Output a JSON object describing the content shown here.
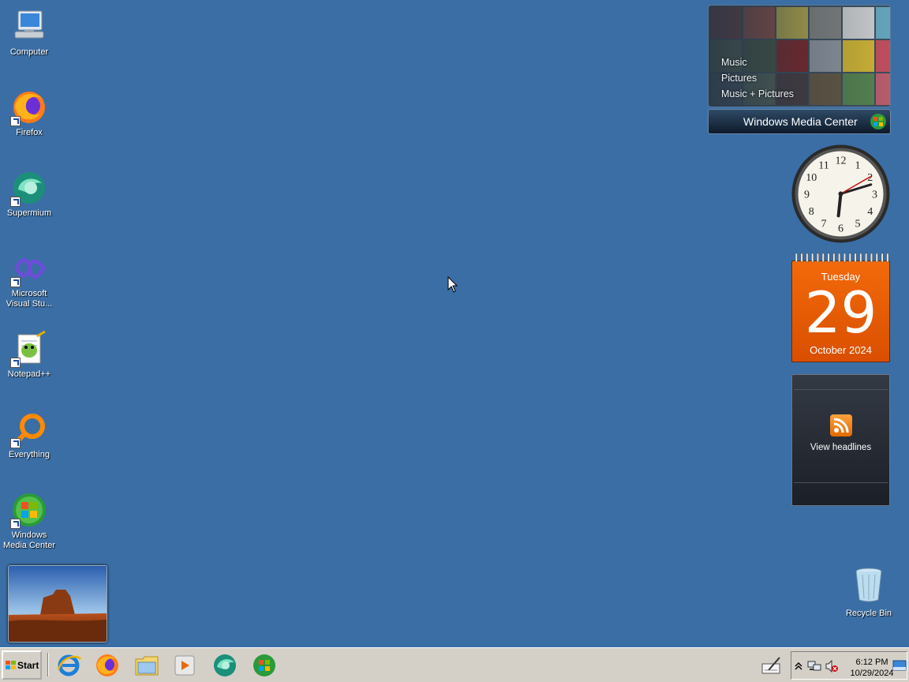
{
  "desktop": {
    "icons": [
      {
        "label": "Computer",
        "icon": "computer-icon"
      },
      {
        "label": "Firefox",
        "icon": "firefox-icon"
      },
      {
        "label": "Supermium",
        "icon": "supermium-icon"
      },
      {
        "label": "Microsoft Visual Stu...",
        "icon": "visual-studio-icon"
      },
      {
        "label": "Notepad++",
        "icon": "notepad-plus-plus-icon"
      },
      {
        "label": "Everything",
        "icon": "everything-search-icon"
      },
      {
        "label": "Windows Media Center",
        "icon": "windows-media-center-icon"
      }
    ],
    "recycle_bin": {
      "label": "Recycle Bin",
      "icon": "recycle-bin-icon"
    },
    "background_color": "#3a6ea5"
  },
  "gadgets": {
    "media_center": {
      "menu": [
        "Music",
        "Pictures",
        "Music + Pictures"
      ],
      "title": "Windows Media Center"
    },
    "clock": {
      "hour": 6,
      "minute": 12,
      "second": 10
    },
    "calendar": {
      "weekday": "Tuesday",
      "day": "29",
      "month_year": "October 2024",
      "color": "#f26a0a"
    },
    "feed_headlines": {
      "label": "View headlines"
    }
  },
  "taskbar": {
    "start_label": "Start",
    "quick_launch": [
      {
        "icon": "internet-explorer-icon"
      },
      {
        "icon": "firefox-icon"
      },
      {
        "icon": "file-explorer-icon"
      },
      {
        "icon": "media-player-icon"
      },
      {
        "icon": "supermium-icon"
      },
      {
        "icon": "windows-media-center-icon"
      }
    ],
    "tray": {
      "time": "6:12 PM",
      "date": "10/29/2024",
      "icons": [
        "show-hidden-icons-icon",
        "network-icon",
        "volume-muted-icon",
        "action-center-icon"
      ]
    }
  }
}
